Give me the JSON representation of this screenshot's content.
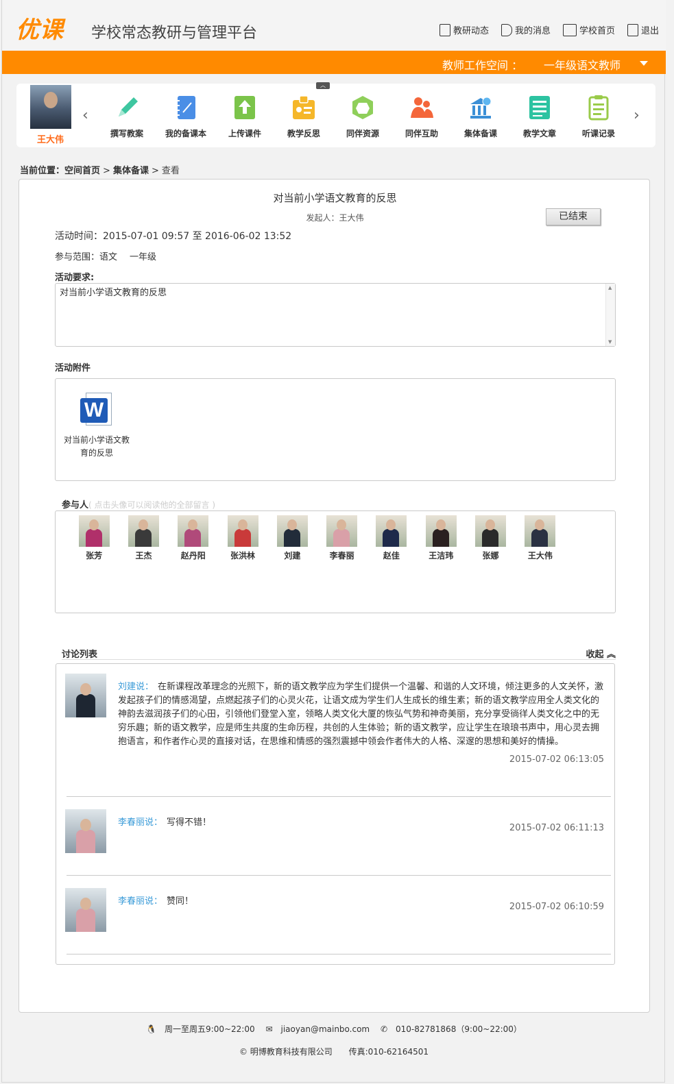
{
  "header": {
    "logo": "优课",
    "site_title": "学校常态教研与管理平台",
    "nav": [
      {
        "label": "教研动态",
        "icon": "document-list-icon"
      },
      {
        "label": "我的消息",
        "icon": "speaker-icon"
      },
      {
        "label": "学校首页",
        "icon": "building-icon"
      },
      {
        "label": "退出",
        "icon": "exit-door-icon"
      }
    ]
  },
  "workspace": {
    "label": "教师工作空间 ：",
    "role": "一年级语文教师"
  },
  "user": {
    "name": "王大伟"
  },
  "tools": [
    {
      "label": "撰写教案",
      "icon": "pencil-icon",
      "color": "#3ec6a0"
    },
    {
      "label": "我的备课本",
      "icon": "notebook-icon",
      "color": "#4a8ee6"
    },
    {
      "label": "上传课件",
      "icon": "upload-icon",
      "color": "#7bc44a"
    },
    {
      "label": "教学反思",
      "icon": "reflection-card-icon",
      "color": "#f5b72a"
    },
    {
      "label": "同伴资源",
      "icon": "hexagon-icon",
      "color": "#8fcf5a"
    },
    {
      "label": "同伴互助",
      "icon": "people-icon",
      "color": "#f4663a"
    },
    {
      "label": "集体备课",
      "icon": "group-building-icon",
      "color": "#3b8fd6"
    },
    {
      "label": "教学文章",
      "icon": "article-icon",
      "color": "#2dc3a1"
    },
    {
      "label": "听课记录",
      "icon": "clipboard-icon",
      "color": "#9acb4a"
    }
  ],
  "breadcrumb": {
    "prefix": "当前位置：",
    "items": [
      "空间首页",
      "集体备课"
    ],
    "current": "查看",
    "sep": ">"
  },
  "activity": {
    "title": "对当前小学语文教育的反思",
    "initiator": "发起人：王大伟",
    "status_button": "已结束",
    "time": "活动时间：2015-07-01 09:57 至 2016-06-02 13:52",
    "scope_label": "参与范围：语文",
    "scope_grade": "一年级",
    "requirement_label": "活动要求:",
    "requirement_text": "对当前小学语文教育的反思",
    "attachment_label": "活动附件",
    "attachment": {
      "name": "对当前小学语文教育的反思",
      "icon": "word-document-icon"
    }
  },
  "participants": {
    "label": "参与人",
    "hint": "( 点击头像可以阅读他的全部留言 )",
    "people": [
      {
        "name": "张芳",
        "color": "#b0306a"
      },
      {
        "name": "王杰",
        "color": "#3a3a3a"
      },
      {
        "name": "赵丹阳",
        "color": "#b04a7a"
      },
      {
        "name": "张洪林",
        "color": "#c93a3a"
      },
      {
        "name": "刘建",
        "color": "#222c3a"
      },
      {
        "name": "李春丽",
        "color": "#d9a0a8"
      },
      {
        "name": "赵佳",
        "color": "#1e2a4a"
      },
      {
        "name": "王洁玮",
        "color": "#2a2020"
      },
      {
        "name": "张娜",
        "color": "#2a2a2a"
      },
      {
        "name": "王大伟",
        "color": "#2a3142"
      }
    ]
  },
  "discussion": {
    "label": "讨论列表",
    "collapse": "收起",
    "comments": [
      {
        "author": "刘建说：",
        "text": "在新课程改革理念的光照下，新的语文教学应为学生们提供一个温馨、和谐的人文环境，倾注更多的人文关怀，激发起孩子们的情感渴望，点燃起孩子们的心灵火花，让语文成为学生们人生成长的维生素；新的语文教学应用全人类文化的神韵去滋润孩子们的心田，引领他们登堂入室，领略人类文化大厦的恢弘气势和神奇美丽，充分享受徜徉人类文化之中的无穷乐趣；新的语文教学，应是师生共度的生命历程，共创的人生体验；新的语文教学，应让学生在琅琅书声中，用心灵去拥抱语言，和作者作心灵的直接对话，在思维和情感的强烈震撼中领会作者伟大的人格、深邃的思想和美好的情操。",
        "time": "2015-07-02 06:13:05",
        "color": "#1e2632"
      },
      {
        "author": "李春丽说：",
        "text": "写得不错！",
        "time": "2015-07-02 06:11:13",
        "color": "#d9a0a8"
      },
      {
        "author": "李春丽说：",
        "text": "赞同！",
        "time": "2015-07-02 06:10:59",
        "color": "#d9a0a8"
      }
    ]
  },
  "footer": {
    "hours": "周一至周五9:00~22:00",
    "email": "jiaoyan@mainbo.com",
    "phone": "010-82781868（9:00~22:00）",
    "copyright": "© 明博教育科技有限公司",
    "fax": "传真:010-62164501"
  }
}
